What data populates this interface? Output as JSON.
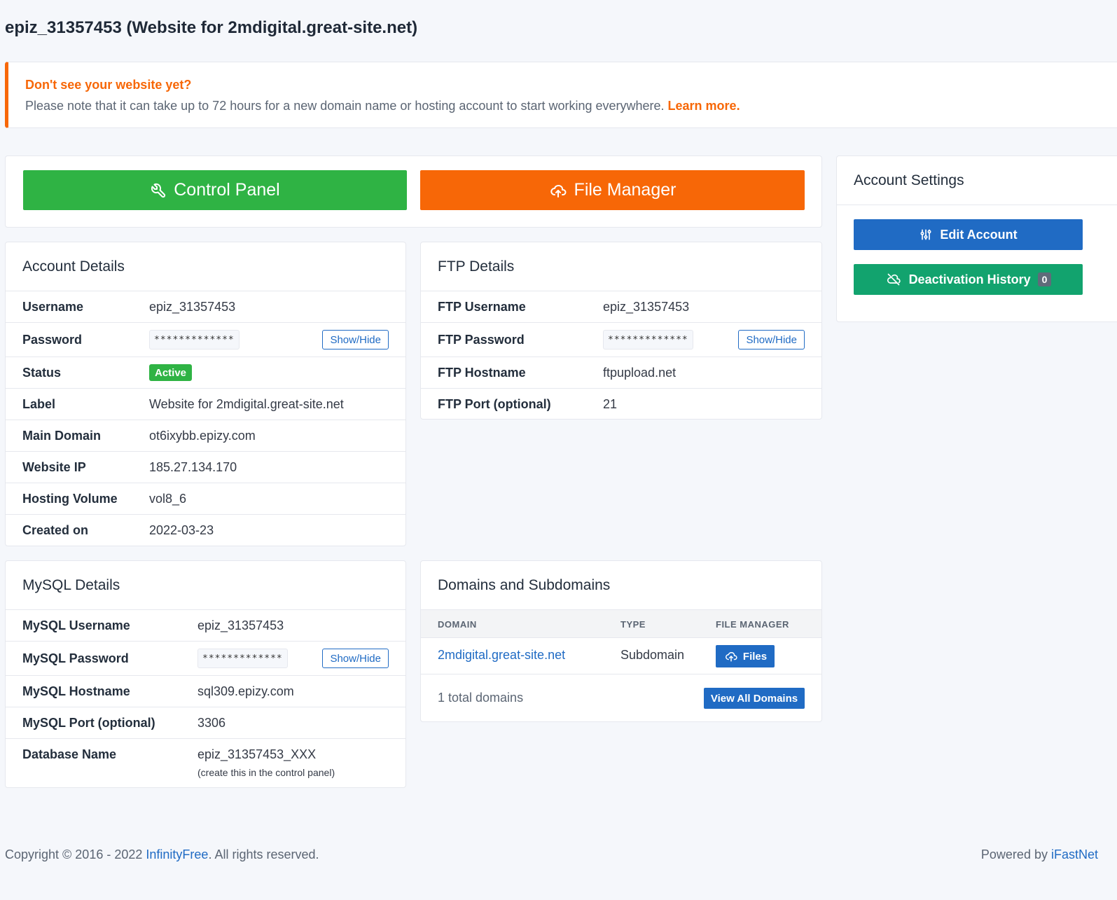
{
  "page": {
    "title": "epiz_31357453 (Website for 2mdigital.great-site.net)"
  },
  "alert": {
    "title": "Don't see your website yet?",
    "text": "Please note that it can take up to 72 hours for a new domain name or hosting account to start working everywhere.",
    "link": "Learn more."
  },
  "actions": {
    "control_panel": "Control Panel",
    "file_manager": "File Manager",
    "control_panel_color": "#2fb344",
    "file_manager_color": "#f76707"
  },
  "account_details": {
    "title": "Account Details",
    "username_label": "Username",
    "username": "epiz_31357453",
    "password_label": "Password",
    "password_mask": "*************",
    "show_hide": "Show/Hide",
    "status_label": "Status",
    "status": "Active",
    "label_label": "Label",
    "label": "Website for 2mdigital.great-site.net",
    "main_domain_label": "Main Domain",
    "main_domain": "ot6ixybb.epizy.com",
    "website_ip_label": "Website IP",
    "website_ip": "185.27.134.170",
    "hosting_volume_label": "Hosting Volume",
    "hosting_volume": "vol8_6",
    "created_label": "Created on",
    "created": "2022-03-23"
  },
  "ftp_details": {
    "title": "FTP Details",
    "username_label": "FTP Username",
    "username": "epiz_31357453",
    "password_label": "FTP Password",
    "password_mask": "*************",
    "show_hide": "Show/Hide",
    "hostname_label": "FTP Hostname",
    "hostname": "ftpupload.net",
    "port_label": "FTP Port (optional)",
    "port": "21"
  },
  "account_settings": {
    "title": "Account Settings",
    "edit": "Edit Account",
    "deactivation": "Deactivation History",
    "deactivation_count": "0",
    "edit_color": "#206bc4",
    "deactivation_color": "#12a36e"
  },
  "mysql_details": {
    "title": "MySQL Details",
    "username_label": "MySQL Username",
    "username": "epiz_31357453",
    "password_label": "MySQL Password",
    "password_mask": "*************",
    "show_hide": "Show/Hide",
    "hostname_label": "MySQL Hostname",
    "hostname": "sql309.epizy.com",
    "port_label": "MySQL Port (optional)",
    "port": "3306",
    "dbname_label": "Database Name",
    "dbname": "epiz_31357453_XXX",
    "dbname_note": "(create this in the control panel)"
  },
  "domains": {
    "title": "Domains and Subdomains",
    "columns": [
      "DOMAIN",
      "TYPE",
      "FILE MANAGER"
    ],
    "rows": [
      {
        "domain": "2mdigital.great-site.net",
        "type": "Subdomain",
        "action": "Files"
      }
    ],
    "total": "1 total domains",
    "view_all": "View All Domains"
  },
  "footer": {
    "copyright_prefix": "Copyright © 2016 - 2022 ",
    "brand": "InfinityFree",
    "copyright_suffix": ". All rights reserved.",
    "powered_prefix": "Powered by ",
    "powered_brand": "iFastNet"
  }
}
